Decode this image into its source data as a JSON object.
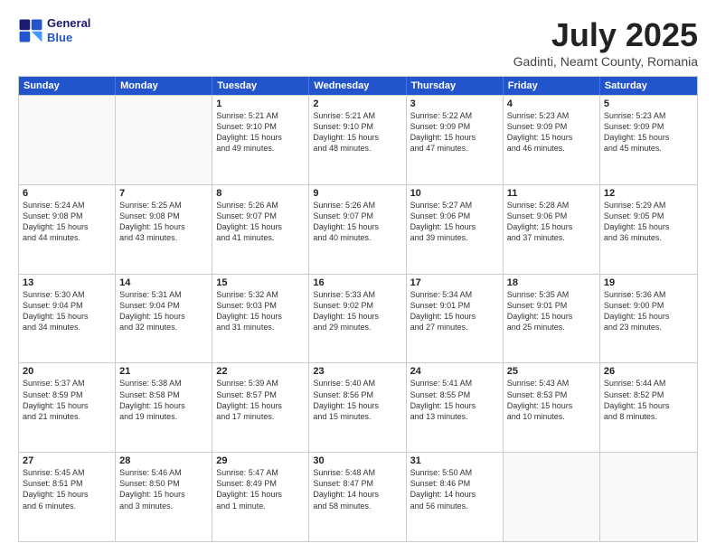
{
  "header": {
    "logo_line1": "General",
    "logo_line2": "Blue",
    "title": "July 2025",
    "subtitle": "Gadinti, Neamt County, Romania"
  },
  "weekdays": [
    "Sunday",
    "Monday",
    "Tuesday",
    "Wednesday",
    "Thursday",
    "Friday",
    "Saturday"
  ],
  "rows": [
    [
      {
        "day": "",
        "lines": [],
        "empty": true
      },
      {
        "day": "",
        "lines": [],
        "empty": true
      },
      {
        "day": "1",
        "lines": [
          "Sunrise: 5:21 AM",
          "Sunset: 9:10 PM",
          "Daylight: 15 hours",
          "and 49 minutes."
        ]
      },
      {
        "day": "2",
        "lines": [
          "Sunrise: 5:21 AM",
          "Sunset: 9:10 PM",
          "Daylight: 15 hours",
          "and 48 minutes."
        ]
      },
      {
        "day": "3",
        "lines": [
          "Sunrise: 5:22 AM",
          "Sunset: 9:09 PM",
          "Daylight: 15 hours",
          "and 47 minutes."
        ]
      },
      {
        "day": "4",
        "lines": [
          "Sunrise: 5:23 AM",
          "Sunset: 9:09 PM",
          "Daylight: 15 hours",
          "and 46 minutes."
        ]
      },
      {
        "day": "5",
        "lines": [
          "Sunrise: 5:23 AM",
          "Sunset: 9:09 PM",
          "Daylight: 15 hours",
          "and 45 minutes."
        ]
      }
    ],
    [
      {
        "day": "6",
        "lines": [
          "Sunrise: 5:24 AM",
          "Sunset: 9:08 PM",
          "Daylight: 15 hours",
          "and 44 minutes."
        ]
      },
      {
        "day": "7",
        "lines": [
          "Sunrise: 5:25 AM",
          "Sunset: 9:08 PM",
          "Daylight: 15 hours",
          "and 43 minutes."
        ]
      },
      {
        "day": "8",
        "lines": [
          "Sunrise: 5:26 AM",
          "Sunset: 9:07 PM",
          "Daylight: 15 hours",
          "and 41 minutes."
        ]
      },
      {
        "day": "9",
        "lines": [
          "Sunrise: 5:26 AM",
          "Sunset: 9:07 PM",
          "Daylight: 15 hours",
          "and 40 minutes."
        ]
      },
      {
        "day": "10",
        "lines": [
          "Sunrise: 5:27 AM",
          "Sunset: 9:06 PM",
          "Daylight: 15 hours",
          "and 39 minutes."
        ]
      },
      {
        "day": "11",
        "lines": [
          "Sunrise: 5:28 AM",
          "Sunset: 9:06 PM",
          "Daylight: 15 hours",
          "and 37 minutes."
        ]
      },
      {
        "day": "12",
        "lines": [
          "Sunrise: 5:29 AM",
          "Sunset: 9:05 PM",
          "Daylight: 15 hours",
          "and 36 minutes."
        ]
      }
    ],
    [
      {
        "day": "13",
        "lines": [
          "Sunrise: 5:30 AM",
          "Sunset: 9:04 PM",
          "Daylight: 15 hours",
          "and 34 minutes."
        ]
      },
      {
        "day": "14",
        "lines": [
          "Sunrise: 5:31 AM",
          "Sunset: 9:04 PM",
          "Daylight: 15 hours",
          "and 32 minutes."
        ]
      },
      {
        "day": "15",
        "lines": [
          "Sunrise: 5:32 AM",
          "Sunset: 9:03 PM",
          "Daylight: 15 hours",
          "and 31 minutes."
        ]
      },
      {
        "day": "16",
        "lines": [
          "Sunrise: 5:33 AM",
          "Sunset: 9:02 PM",
          "Daylight: 15 hours",
          "and 29 minutes."
        ]
      },
      {
        "day": "17",
        "lines": [
          "Sunrise: 5:34 AM",
          "Sunset: 9:01 PM",
          "Daylight: 15 hours",
          "and 27 minutes."
        ]
      },
      {
        "day": "18",
        "lines": [
          "Sunrise: 5:35 AM",
          "Sunset: 9:01 PM",
          "Daylight: 15 hours",
          "and 25 minutes."
        ]
      },
      {
        "day": "19",
        "lines": [
          "Sunrise: 5:36 AM",
          "Sunset: 9:00 PM",
          "Daylight: 15 hours",
          "and 23 minutes."
        ]
      }
    ],
    [
      {
        "day": "20",
        "lines": [
          "Sunrise: 5:37 AM",
          "Sunset: 8:59 PM",
          "Daylight: 15 hours",
          "and 21 minutes."
        ]
      },
      {
        "day": "21",
        "lines": [
          "Sunrise: 5:38 AM",
          "Sunset: 8:58 PM",
          "Daylight: 15 hours",
          "and 19 minutes."
        ]
      },
      {
        "day": "22",
        "lines": [
          "Sunrise: 5:39 AM",
          "Sunset: 8:57 PM",
          "Daylight: 15 hours",
          "and 17 minutes."
        ]
      },
      {
        "day": "23",
        "lines": [
          "Sunrise: 5:40 AM",
          "Sunset: 8:56 PM",
          "Daylight: 15 hours",
          "and 15 minutes."
        ]
      },
      {
        "day": "24",
        "lines": [
          "Sunrise: 5:41 AM",
          "Sunset: 8:55 PM",
          "Daylight: 15 hours",
          "and 13 minutes."
        ]
      },
      {
        "day": "25",
        "lines": [
          "Sunrise: 5:43 AM",
          "Sunset: 8:53 PM",
          "Daylight: 15 hours",
          "and 10 minutes."
        ]
      },
      {
        "day": "26",
        "lines": [
          "Sunrise: 5:44 AM",
          "Sunset: 8:52 PM",
          "Daylight: 15 hours",
          "and 8 minutes."
        ]
      }
    ],
    [
      {
        "day": "27",
        "lines": [
          "Sunrise: 5:45 AM",
          "Sunset: 8:51 PM",
          "Daylight: 15 hours",
          "and 6 minutes."
        ]
      },
      {
        "day": "28",
        "lines": [
          "Sunrise: 5:46 AM",
          "Sunset: 8:50 PM",
          "Daylight: 15 hours",
          "and 3 minutes."
        ]
      },
      {
        "day": "29",
        "lines": [
          "Sunrise: 5:47 AM",
          "Sunset: 8:49 PM",
          "Daylight: 15 hours",
          "and 1 minute."
        ]
      },
      {
        "day": "30",
        "lines": [
          "Sunrise: 5:48 AM",
          "Sunset: 8:47 PM",
          "Daylight: 14 hours",
          "and 58 minutes."
        ]
      },
      {
        "day": "31",
        "lines": [
          "Sunrise: 5:50 AM",
          "Sunset: 8:46 PM",
          "Daylight: 14 hours",
          "and 56 minutes."
        ]
      },
      {
        "day": "",
        "lines": [],
        "empty": true
      },
      {
        "day": "",
        "lines": [],
        "empty": true
      }
    ]
  ]
}
